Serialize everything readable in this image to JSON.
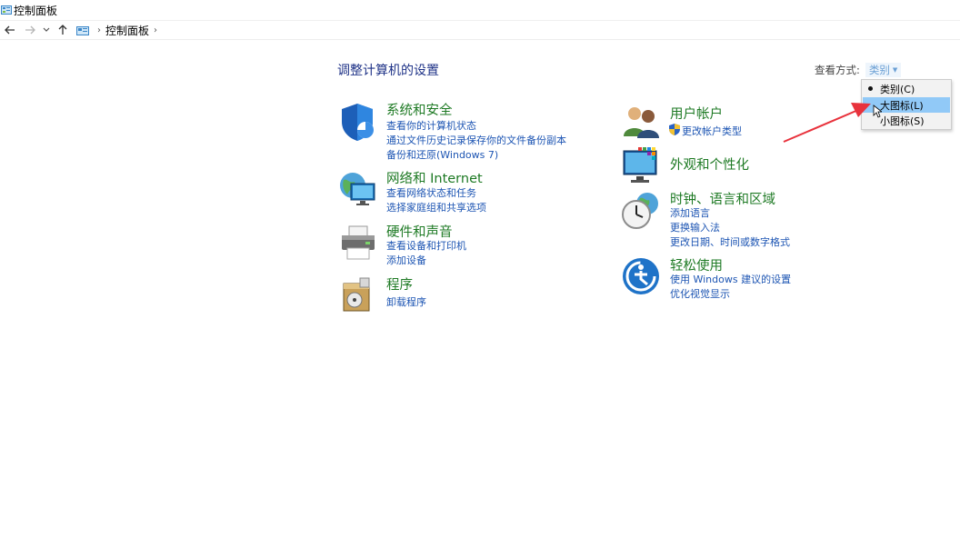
{
  "window": {
    "title": "控制面板"
  },
  "nav": {
    "back_icon": "back-arrow-icon",
    "forward_icon": "forward-arrow-icon",
    "recent_icon": "chevron-down-icon",
    "up_icon": "up-arrow-icon",
    "breadcrumb": [
      "控制面板"
    ]
  },
  "main": {
    "heading": "调整计算机的设置",
    "view_by": {
      "label": "查看方式:",
      "selected": "类别",
      "options": [
        {
          "label": "类别(C)",
          "checked": true,
          "highlighted": false
        },
        {
          "label": "大图标(L)",
          "checked": false,
          "highlighted": true
        },
        {
          "label": "小图标(S)",
          "checked": false,
          "highlighted": false
        }
      ]
    },
    "categories_left": [
      {
        "title": "系统和安全",
        "icon": "shield-icon",
        "links": [
          "查看你的计算机状态",
          "通过文件历史记录保存你的文件备份副本",
          "备份和还原(Windows 7)"
        ]
      },
      {
        "title": "网络和 Internet",
        "icon": "globe-network-icon",
        "links": [
          "查看网络状态和任务",
          "选择家庭组和共享选项"
        ]
      },
      {
        "title": "硬件和声音",
        "icon": "printer-icon",
        "links": [
          "查看设备和打印机",
          "添加设备"
        ]
      },
      {
        "title": "程序",
        "icon": "programs-box-icon",
        "links": [
          "卸载程序"
        ]
      }
    ],
    "categories_right": [
      {
        "title": "用户帐户",
        "icon": "users-icon",
        "links": [
          "更改帐户类型"
        ]
      },
      {
        "title": "外观和个性化",
        "icon": "monitor-palette-icon",
        "links": []
      },
      {
        "title": "时钟、语言和区域",
        "icon": "clock-globe-icon",
        "links": [
          "添加语言",
          "更换输入法",
          "更改日期、时间或数字格式"
        ]
      },
      {
        "title": "轻松使用",
        "icon": "ease-of-access-icon",
        "links": [
          "使用 Windows 建议的设置",
          "优化视觉显示"
        ]
      }
    ]
  },
  "colors": {
    "category_title": "#1e7a24",
    "link": "#1d55b3",
    "heading": "#1e3287",
    "menu_highlight": "#91c9f7",
    "annotation_arrow": "#e8323c"
  }
}
